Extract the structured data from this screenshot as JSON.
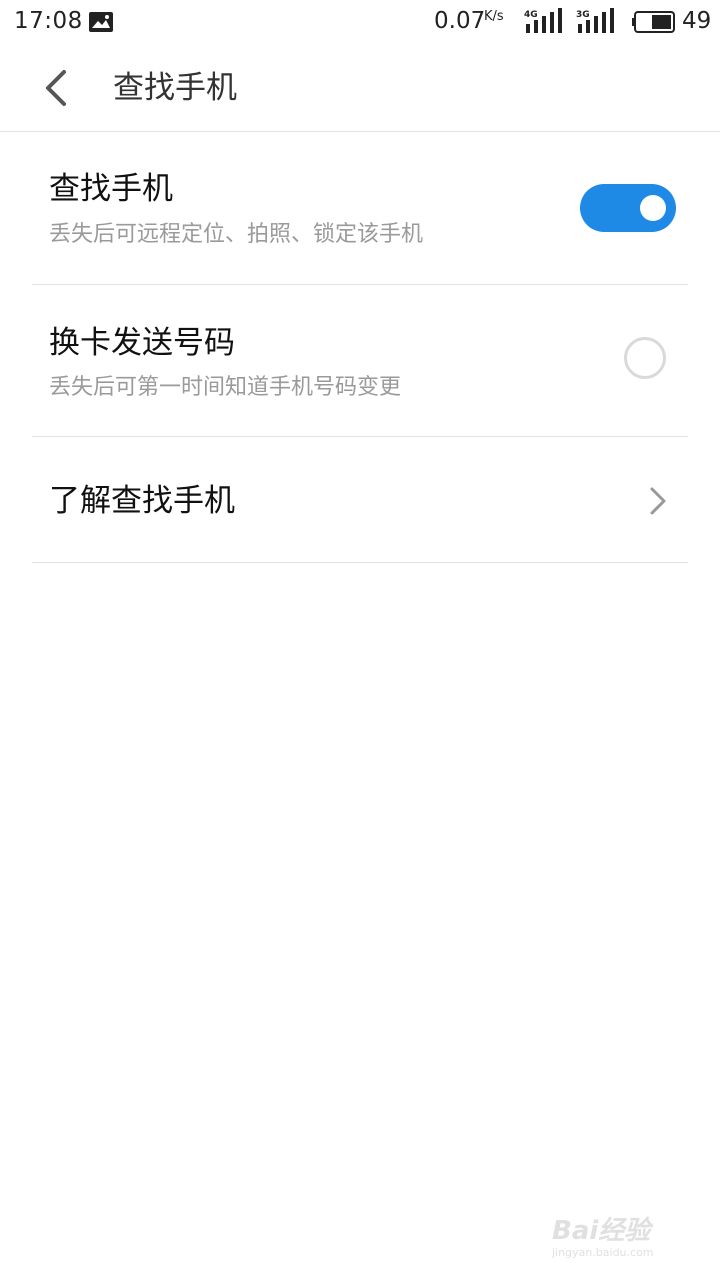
{
  "status_bar": {
    "time": "17:08",
    "net_speed": "0.07",
    "net_speed_unit": "K/s",
    "sim1_network": "4G",
    "sim2_network": "3G",
    "battery": "49",
    "icons": [
      "gallery-notification-icon",
      "signal-icon",
      "battery-icon"
    ]
  },
  "header": {
    "title": "查找手机",
    "back_icon": "back-chevron-icon"
  },
  "settings": {
    "find_phone": {
      "title": "查找手机",
      "subtitle": "丢失后可远程定位、拍照、锁定该手机",
      "enabled": true
    },
    "sim_change": {
      "title": "换卡发送号码",
      "subtitle": "丢失后可第一时间知道手机号码变更",
      "enabled": false
    },
    "learn_more": {
      "title": "了解查找手机",
      "icon": "chevron-right-icon"
    }
  },
  "watermark": {
    "main": "Bai经验",
    "sub": "jingyan.baidu.com"
  },
  "colors": {
    "accent": "#1f8ae6",
    "divider": "#e2e2e2",
    "subtitle": "#9a9a9a"
  }
}
